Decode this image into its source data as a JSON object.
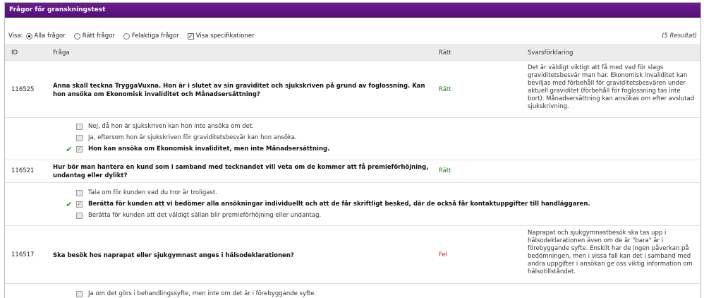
{
  "title": "Frågor för granskningstest",
  "filter": {
    "label": "Visa:",
    "options": [
      "Alla frågor",
      "Rätt frågor",
      "Felaktiga frågor"
    ],
    "selected": "Alla frågor",
    "spec_label": "Visa specifikationer",
    "spec_checked": true,
    "results": "(5 Resultat)"
  },
  "columns": {
    "id": "ID",
    "question": "Fråga",
    "right": "Rätt",
    "explanation": "Svarsförklaring"
  },
  "questions": [
    {
      "id": "116525",
      "text": "Anna skall teckna TryggaVuxna. Hon är i slutet av sin graviditet och sjukskriven på grund av foglossning. Kan hon ansöka om Ekonomisk invaliditet och Månadsersättning?",
      "result": "Rätt",
      "explanation": "Det är väldigt viktigt att få med vad för slags graviditetsbesvär man har. Ekonomisk invaliditet kan beviljas med förbehåll för graviditetsbesvären under aktuell graviditet (förbehåll för foglossning tas inte bort). Månadsersättning kan ansökas om efter avslutad sjukskrivning.",
      "answers": [
        {
          "text": "Nej, då hon är sjukskriven kan hon inte ansöka om det.",
          "correct": false
        },
        {
          "text": "Ja, eftersom hon är sjukskriven för graviditetsbesvär kan hon ansöka.",
          "correct": false
        },
        {
          "text": "Hon kan ansöka om Ekonomisk invaliditet, men inte Månadsersättning.",
          "correct": true
        }
      ]
    },
    {
      "id": "116521",
      "text": "Hur bör man hantera en kund som i samband med tecknandet vill veta om de kommer att få premieförhöjning, undantag eller dylikt?",
      "result": "Rätt",
      "explanation": "",
      "answers": [
        {
          "text": "Tala om för kunden vad du tror är troligast.",
          "correct": false
        },
        {
          "text": "Berätta för kunden att vi bedömer alla ansökningar individuellt och att de får skriftligt besked, där de också får kontaktuppgifter till handläggaren.",
          "correct": true
        },
        {
          "text": "Berätta för kunden att det väldigt sällan blir premieförhöjning eller undantag.",
          "correct": false
        }
      ]
    },
    {
      "id": "116517",
      "text": "Ska besök hos naprapat eller sjukgymnast anges i hälsodeklarationen?",
      "result": "Fel",
      "explanation": "Naprapat och sjukgymnastbesök ska tas upp i hälsodeklarationen även om de är \"bara\" är i förebyggande syfte. Enskilt har de ingen påverkan på bedömningen, men i vissa fall kan det i samband med andra uppgifter i ansökan ge oss viktig information om hälsotillståndet.",
      "answers": [
        {
          "text": "Ja om det görs i behandlingssyfte, men inte om det är i förebyggande syfte.",
          "correct": false
        }
      ]
    }
  ]
}
